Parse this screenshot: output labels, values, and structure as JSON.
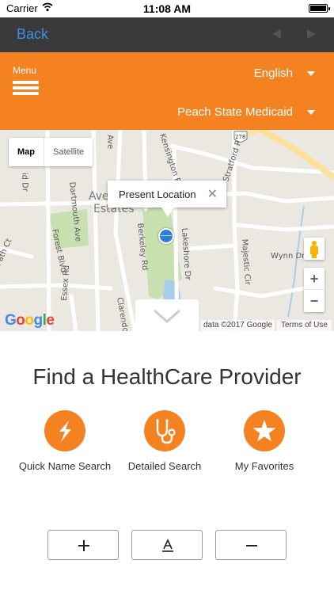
{
  "status_bar": {
    "carrier": "Carrier",
    "time": "11:08 AM"
  },
  "nav": {
    "back_label": "Back"
  },
  "header": {
    "menu_label": "Menu",
    "language": "English",
    "plan": "Peach State Medicaid",
    "accent_color": "#f58220"
  },
  "map": {
    "type_map": "Map",
    "type_satellite": "Satellite",
    "info_window_label": "Present Location",
    "info_close": "✕",
    "zoom_in": "+",
    "zoom_out": "−",
    "logo_letters": [
      "G",
      "o",
      "o",
      "g",
      "l",
      "e"
    ],
    "attribution": "data ©2017 Google",
    "terms": "Terms of Use",
    "streets": [
      "Dartmouth Ave",
      "Forest Blvd",
      "Berkeley Rd",
      "Lakeshore Dr",
      "Kensington Rd",
      "Stratford Rd",
      "Wynn Dr",
      "Majestic Cir",
      "Clarendon",
      "Essex Rd",
      "Path Ct",
      "Avondale Estates"
    ],
    "highway": "278"
  },
  "main": {
    "title": "Find a HealthCare Provider",
    "actions": [
      {
        "label": "Quick Name Search",
        "icon": "lightning-icon"
      },
      {
        "label": "Detailed Search",
        "icon": "stethoscope-icon"
      },
      {
        "label": "My Favorites",
        "icon": "star-icon"
      }
    ],
    "font_buttons": [
      {
        "icon": "plus-icon"
      },
      {
        "icon": "font-size-icon"
      },
      {
        "icon": "minus-icon"
      }
    ]
  }
}
